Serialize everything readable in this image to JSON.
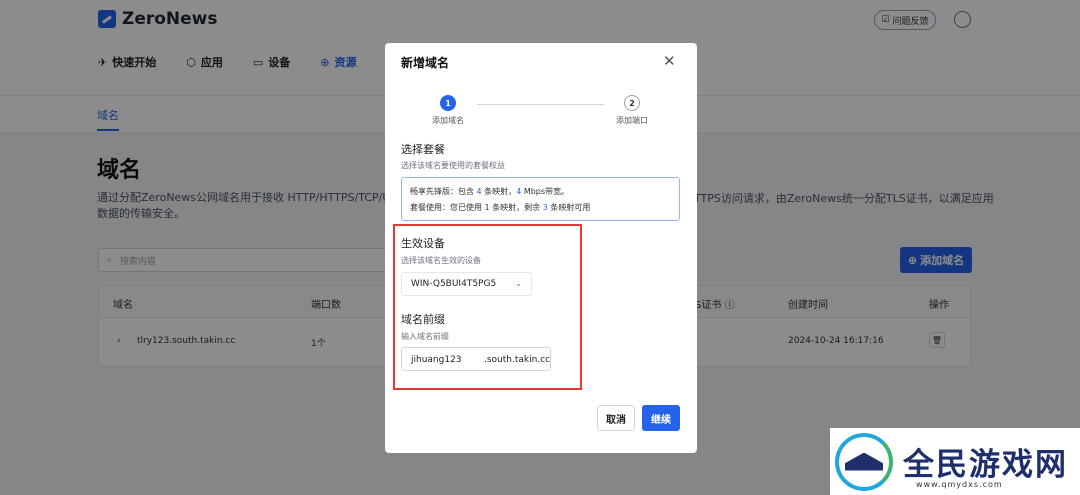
{
  "app": {
    "name": "ZeroNews",
    "feedback": "问题反馈"
  },
  "nav": [
    {
      "label": "快速开始",
      "icon": "rocket-icon",
      "glyph": "✈"
    },
    {
      "label": "应用",
      "icon": "cube-icon",
      "glyph": "⬡"
    },
    {
      "label": "设备",
      "icon": "monitor-icon",
      "glyph": "▭"
    },
    {
      "label": "资源",
      "icon": "globe-icon",
      "glyph": "⊕"
    }
  ],
  "subtab": "域名",
  "page": {
    "title": "域名",
    "desc_left": "通过分配ZeroNews公网域名用于接收 HTTP/HTTPS/TCP/UDP的",
    "desc_right": "TTPS访问请求，由ZeroNews统一分配TLS证书，以满足应用",
    "desc_line2": "数据的传输安全。",
    "search_placeholder": "搜索内容",
    "add_button": "添加域名"
  },
  "table": {
    "headers": [
      "域名",
      "端口数",
      "S证书",
      "创建时间",
      "操作"
    ],
    "rows": [
      {
        "domain": "tlry123.south.takin.cc",
        "ports": "1个",
        "created": "2024-10-24 16:17:16"
      }
    ]
  },
  "modal": {
    "title": "新增域名",
    "steps": [
      {
        "num": "1",
        "label": "添加域名"
      },
      {
        "num": "2",
        "label": "添加端口"
      }
    ],
    "plan": {
      "title": "选择套餐",
      "subtitle": "选择该域名要使用的套餐权益",
      "line1_a": "畅享先锋版：包含 ",
      "line1_n1": "4",
      "line1_b": " 条映射，",
      "line1_n2": "4",
      "line1_c": " Mbps带宽。",
      "line2_a": "套餐使用：您已使用 1 条映射，剩余 ",
      "line2_n": "3",
      "line2_b": " 条映射可用"
    },
    "device": {
      "title": "生效设备",
      "subtitle": "选择该域名生效的设备",
      "value": "WIN-Q5BUI4T5PG5"
    },
    "prefix": {
      "title": "域名前缀",
      "subtitle": "输入域名前缀",
      "value": "jihuang123",
      "suffix": ".south.takin.cc"
    },
    "cancel": "取消",
    "next": "继续"
  },
  "watermark": {
    "name": "全民游戏网",
    "url": "www.qmydxs.com"
  },
  "colors": {
    "primary": "#2563eb",
    "highlight": "#e53935"
  }
}
